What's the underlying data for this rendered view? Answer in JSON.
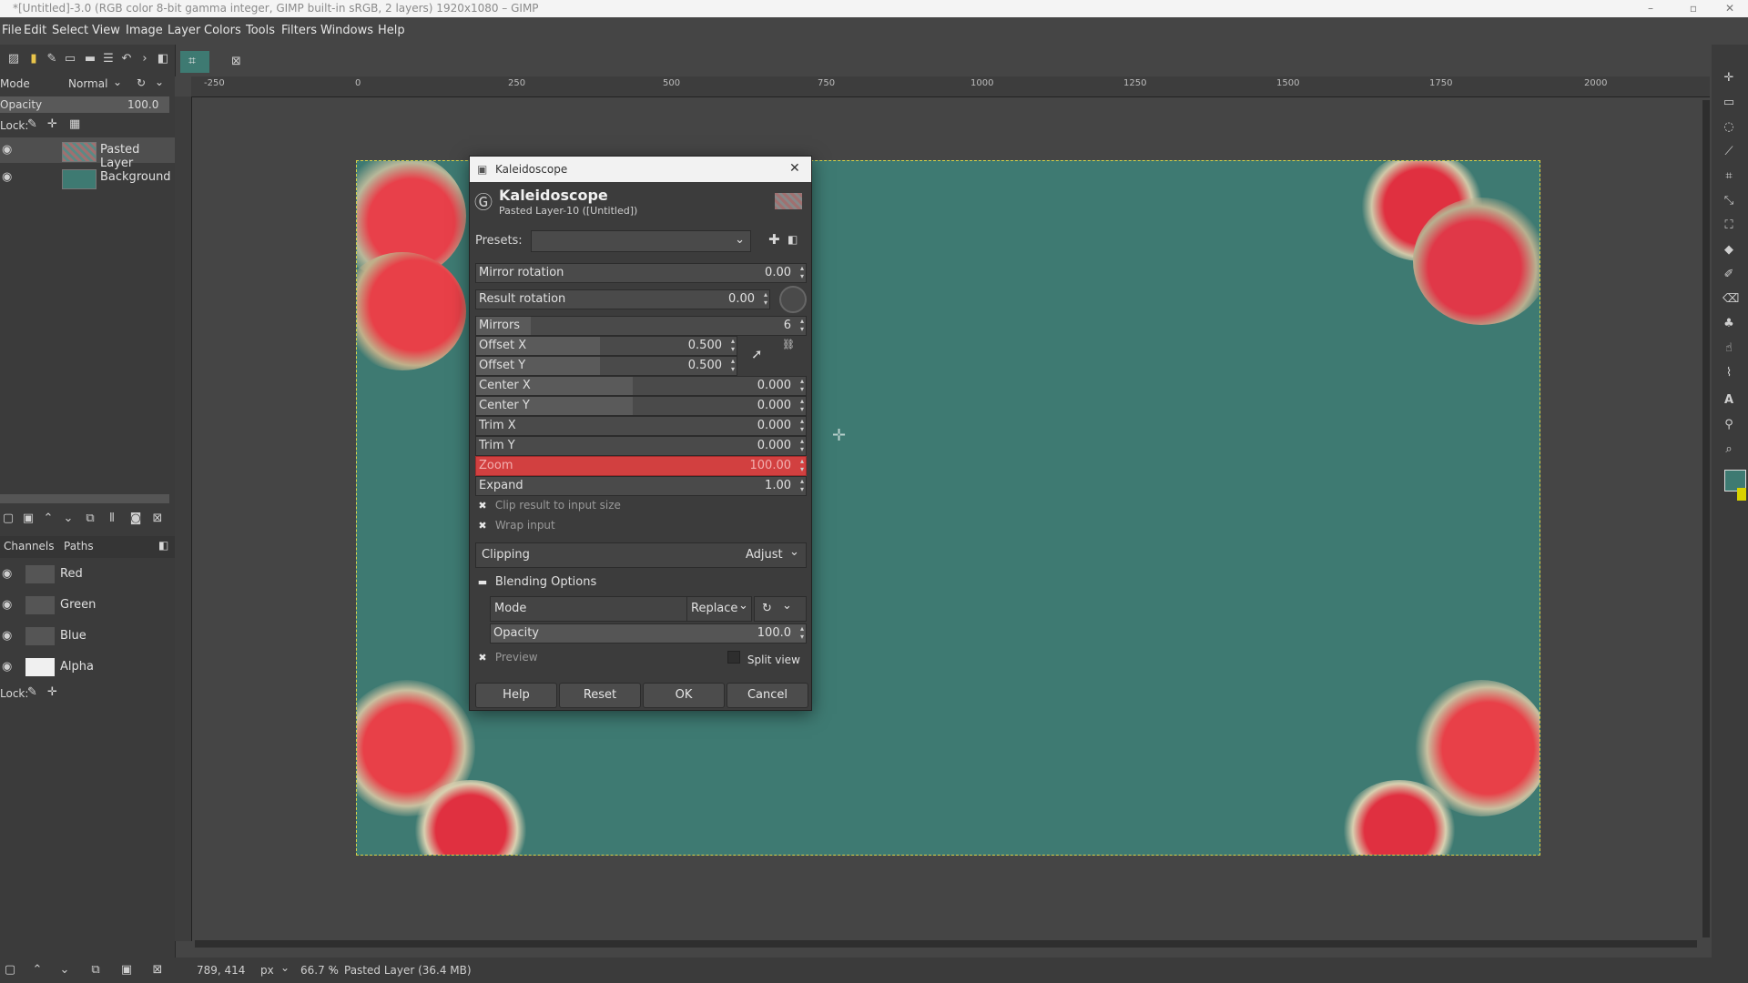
{
  "window": {
    "title": "*[Untitled]-3.0 (RGB color 8-bit gamma integer, GIMP built-in sRGB, 2 layers) 1920x1080 – GIMP"
  },
  "menu": [
    "File",
    "Edit",
    "Select",
    "View",
    "Image",
    "Layer",
    "Colors",
    "Tools",
    "Filters",
    "Windows",
    "Help"
  ],
  "layers_panel": {
    "mode_label": "Mode",
    "mode_value": "Normal",
    "opacity_label": "Opacity",
    "opacity_value": "100.0",
    "lock_label": "Lock:",
    "layers": [
      {
        "name": "Pasted Layer"
      },
      {
        "name": "Background"
      }
    ]
  },
  "channels_panel": {
    "tabs": [
      "Channels",
      "Paths"
    ],
    "channels": [
      {
        "name": "Red"
      },
      {
        "name": "Green"
      },
      {
        "name": "Blue"
      },
      {
        "name": "Alpha"
      }
    ],
    "lock_label": "Lock:"
  },
  "ruler": {
    "ticks": [
      "-250",
      "0",
      "250",
      "500",
      "750",
      "1000",
      "1250",
      "1500",
      "1750",
      "2000"
    ]
  },
  "colors": {
    "canvas": "#3e7a72",
    "zoom_highlight": "#d24040",
    "fg_color": "#3e7a72",
    "bg_color": "#d8d200"
  },
  "dialog": {
    "window_title": "Kaleidoscope",
    "heading": "Kaleidoscope",
    "subheading": "Pasted Layer-10 ([Untitled])",
    "presets_label": "Presets:",
    "params": [
      {
        "label": "Mirror rotation",
        "value": "0.00"
      },
      {
        "label": "Result rotation",
        "value": "0.00"
      },
      {
        "label": "Mirrors",
        "value": "6"
      },
      {
        "label": "Offset X",
        "value": "0.500"
      },
      {
        "label": "Offset Y",
        "value": "0.500"
      },
      {
        "label": "Center X",
        "value": "0.000"
      },
      {
        "label": "Center Y",
        "value": "0.000"
      },
      {
        "label": "Trim X",
        "value": "0.000"
      },
      {
        "label": "Trim Y",
        "value": "0.000"
      },
      {
        "label": "Zoom",
        "value": "100.00"
      },
      {
        "label": "Expand",
        "value": "1.00"
      }
    ],
    "clip_result": "Clip result to input size",
    "wrap_input": "Wrap input",
    "clipping_label": "Clipping",
    "clipping_value": "Adjust",
    "blending_label": "Blending Options",
    "mode_label": "Mode",
    "mode_value": "Replace",
    "opacity_label": "Opacity",
    "opacity_value": "100.0",
    "preview_label": "Preview",
    "split_view_label": "Split view",
    "buttons": {
      "help": "Help",
      "reset": "Reset",
      "ok": "OK",
      "cancel": "Cancel"
    }
  },
  "status": {
    "coords": "789, 414",
    "unit": "px",
    "zoom": "66.7 %",
    "info": "Pasted Layer (36.4 MB)"
  }
}
